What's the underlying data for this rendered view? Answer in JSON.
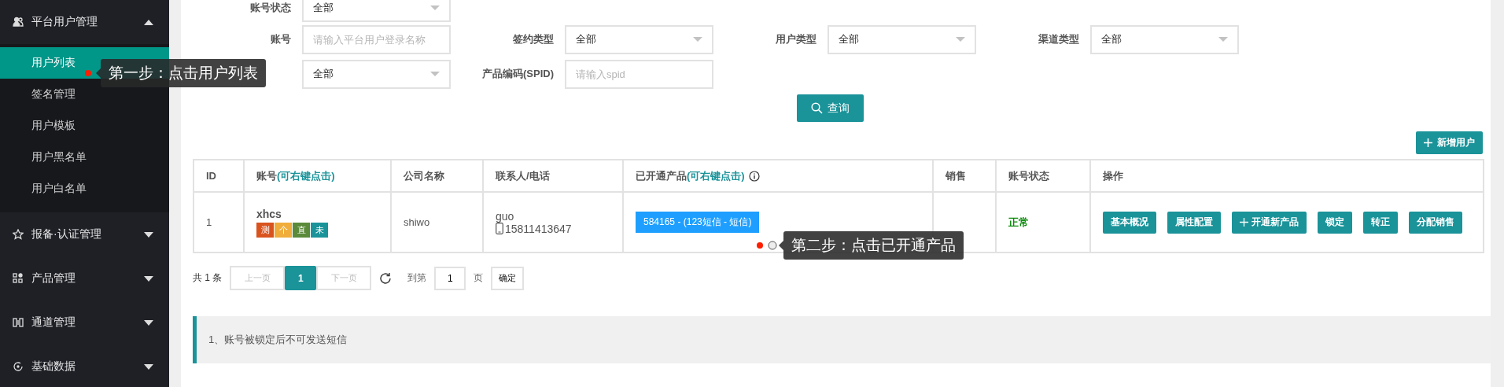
{
  "sidebar": {
    "groups": [
      {
        "label": "平台用户管理",
        "expanded": true,
        "children": [
          {
            "label": "用户列表",
            "selected": true
          },
          {
            "label": "签名管理",
            "selected": false
          },
          {
            "label": "用户模板",
            "selected": false
          },
          {
            "label": "用户黑名单",
            "selected": false
          },
          {
            "label": "用户白名单",
            "selected": false
          }
        ]
      },
      {
        "label": "报备·认证管理",
        "expanded": false
      },
      {
        "label": "产品管理",
        "expanded": false
      },
      {
        "label": "通道管理",
        "expanded": false
      },
      {
        "label": "基础数据",
        "expanded": false
      }
    ]
  },
  "tooltips": [
    {
      "text": "第一步：点击用户列表"
    },
    {
      "text": "第二步：点击已开通产品"
    }
  ],
  "filters": {
    "rows": [
      [
        {
          "label": "账号状态",
          "kind": "select",
          "value": "全部"
        }
      ],
      [
        {
          "label": "账号",
          "kind": "input",
          "placeholder": "请输入平台用户登录名称"
        },
        {
          "label": "签约类型",
          "kind": "select",
          "value": "全部"
        },
        {
          "label": "用户类型",
          "kind": "select",
          "value": "全部"
        },
        {
          "label": "渠道类型",
          "kind": "select",
          "value": "全部"
        }
      ],
      [
        {
          "kind": "select",
          "value": "全部"
        },
        {
          "label": "产品编码(SPID)",
          "kind": "input",
          "placeholder": "请输入spid"
        }
      ]
    ],
    "search_button": "查询"
  },
  "add_button": "新增用户",
  "table": {
    "columns": [
      {
        "label": "ID"
      },
      {
        "label": "账号",
        "hint": "(可右键点击)"
      },
      {
        "label": "公司名称"
      },
      {
        "label": "联系人/电话"
      },
      {
        "label": "已开通产品",
        "hint": "(可右键点击)",
        "info": true
      },
      {
        "label": "销售"
      },
      {
        "label": "账号状态"
      },
      {
        "label": "操作"
      }
    ],
    "rows": [
      {
        "id": "1",
        "account": "xhcs",
        "tags": [
          {
            "text": "测",
            "color": "#d9531e"
          },
          {
            "text": "个",
            "color": "#f0ad3c"
          },
          {
            "text": "直",
            "color": "#5a8a3a"
          },
          {
            "text": "未",
            "color": "#1a9399"
          }
        ],
        "company": "shiwo",
        "contact": "guo",
        "phone": "15811413647",
        "product": "584165 - (123短信 - 短信)",
        "status": "正常",
        "actions": [
          {
            "label": "基本概况",
            "kind": "plain"
          },
          {
            "label": "属性配置",
            "kind": "plain"
          },
          {
            "label": "开通新产品",
            "kind": "plus"
          },
          {
            "label": "锁定",
            "kind": "plain"
          },
          {
            "label": "转正",
            "kind": "plain"
          },
          {
            "label": "分配销售",
            "kind": "plain"
          }
        ]
      }
    ]
  },
  "pagination": {
    "total": "共 1 条",
    "prev": {
      "label": "上一页",
      "disabled": true
    },
    "pages": [
      {
        "label": "1",
        "selected": true
      }
    ],
    "next": {
      "label": "下一页",
      "disabled": true
    },
    "goto": "到第",
    "page_value": "1",
    "page_unit": "页",
    "confirm": "确定"
  },
  "note": "1、账号被锁定后不可发送短信"
}
